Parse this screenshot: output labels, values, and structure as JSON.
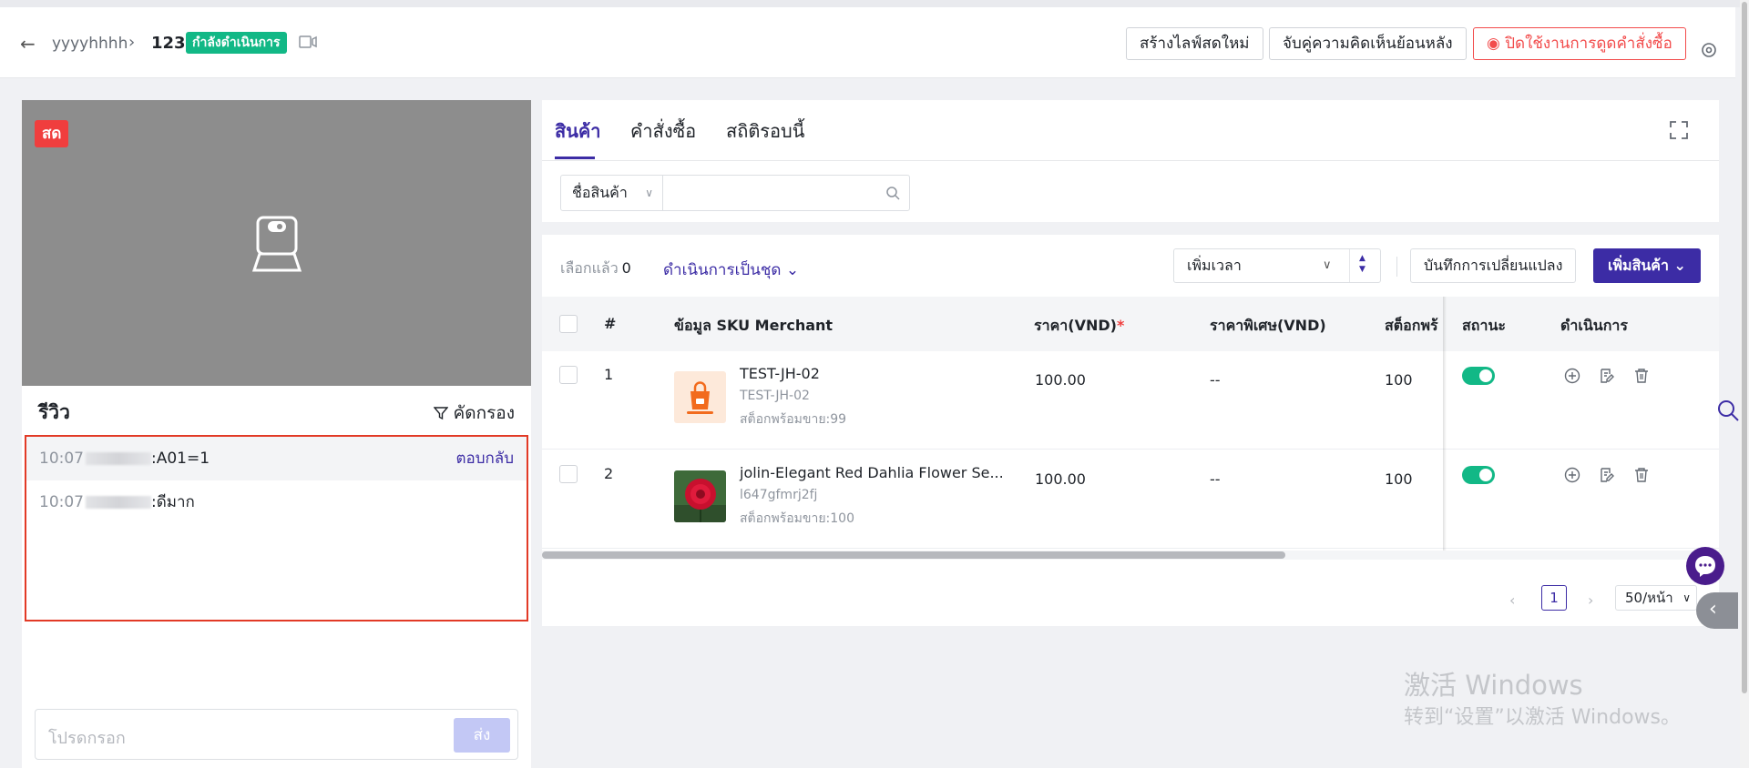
{
  "header": {
    "back_icon": "arrow-left-icon",
    "breadcrumb_name": "yyyyhhhh",
    "session_id": "123",
    "status_badge": "กำลังดำเนินการ",
    "create_live_label": "สร้างไลฟ์สดใหม่",
    "match_feedback_label": "จับคู่ความคิดเห็นย้อนหลัง",
    "disable_order_pull_label": "ปิดใช้งานการดูดคำสั่งซื้อ"
  },
  "video": {
    "live_badge": "สด"
  },
  "reviews": {
    "title": "รีวิว",
    "filter_label": "คัดกรอง",
    "comments": [
      {
        "time": "10:07",
        "text": ":A01=1",
        "reply": "ตอบกลับ"
      },
      {
        "time": "10:07",
        "text": ":ดีมาก"
      }
    ],
    "input_placeholder": "โปรดกรอก",
    "send_label": "ส่ง"
  },
  "tabs": [
    {
      "label": "สินค้า",
      "active": true
    },
    {
      "label": "คำสั่งซื้อ",
      "active": false
    },
    {
      "label": "สถิติรอบนี้",
      "active": false
    }
  ],
  "search": {
    "field_select": "ชื่อสินค้า",
    "placeholder": ""
  },
  "toolbar": {
    "selected_label": "เลือกแล้ว",
    "selected_count": "0",
    "bulk_label": "ดำเนินการเป็นชุด",
    "time_select": "เพิ่มเวลา",
    "record_changes_label": "บันทึกการเปลี่ยนแปลง",
    "add_product_label": "เพิ่มสินค้า"
  },
  "table": {
    "columns": [
      "#",
      "ข้อมูล SKU Merchant",
      "ราคา(VND)",
      "ราคาพิเศษ(VND)",
      "สต็อกพร้",
      "สถานะ",
      "ดำเนินการ"
    ],
    "rows": [
      {
        "index": "1",
        "name": "TEST-JH-02",
        "sku": "TEST-JH-02",
        "stock_text": "สต็อกพร้อมขาย:99",
        "price": "100.00",
        "special": "--",
        "stock": "100",
        "status_on": true
      },
      {
        "index": "2",
        "name": "jolin-Elegant Red Dahlia Flower Se...",
        "sku": "l647gfmrj2fj",
        "stock_text": "สต็อกพร้อมขาย:100",
        "price": "100.00",
        "special": "--",
        "stock": "100",
        "status_on": true
      }
    ]
  },
  "pagination": {
    "current": "1",
    "page_size": "50/หน้า"
  },
  "watermark": {
    "line1": "激活 Windows",
    "line2": "转到“设置”以激活 Windows。"
  },
  "colors": {
    "primary": "#3c2ca5",
    "success": "#12b886",
    "danger": "#f03e3e"
  }
}
